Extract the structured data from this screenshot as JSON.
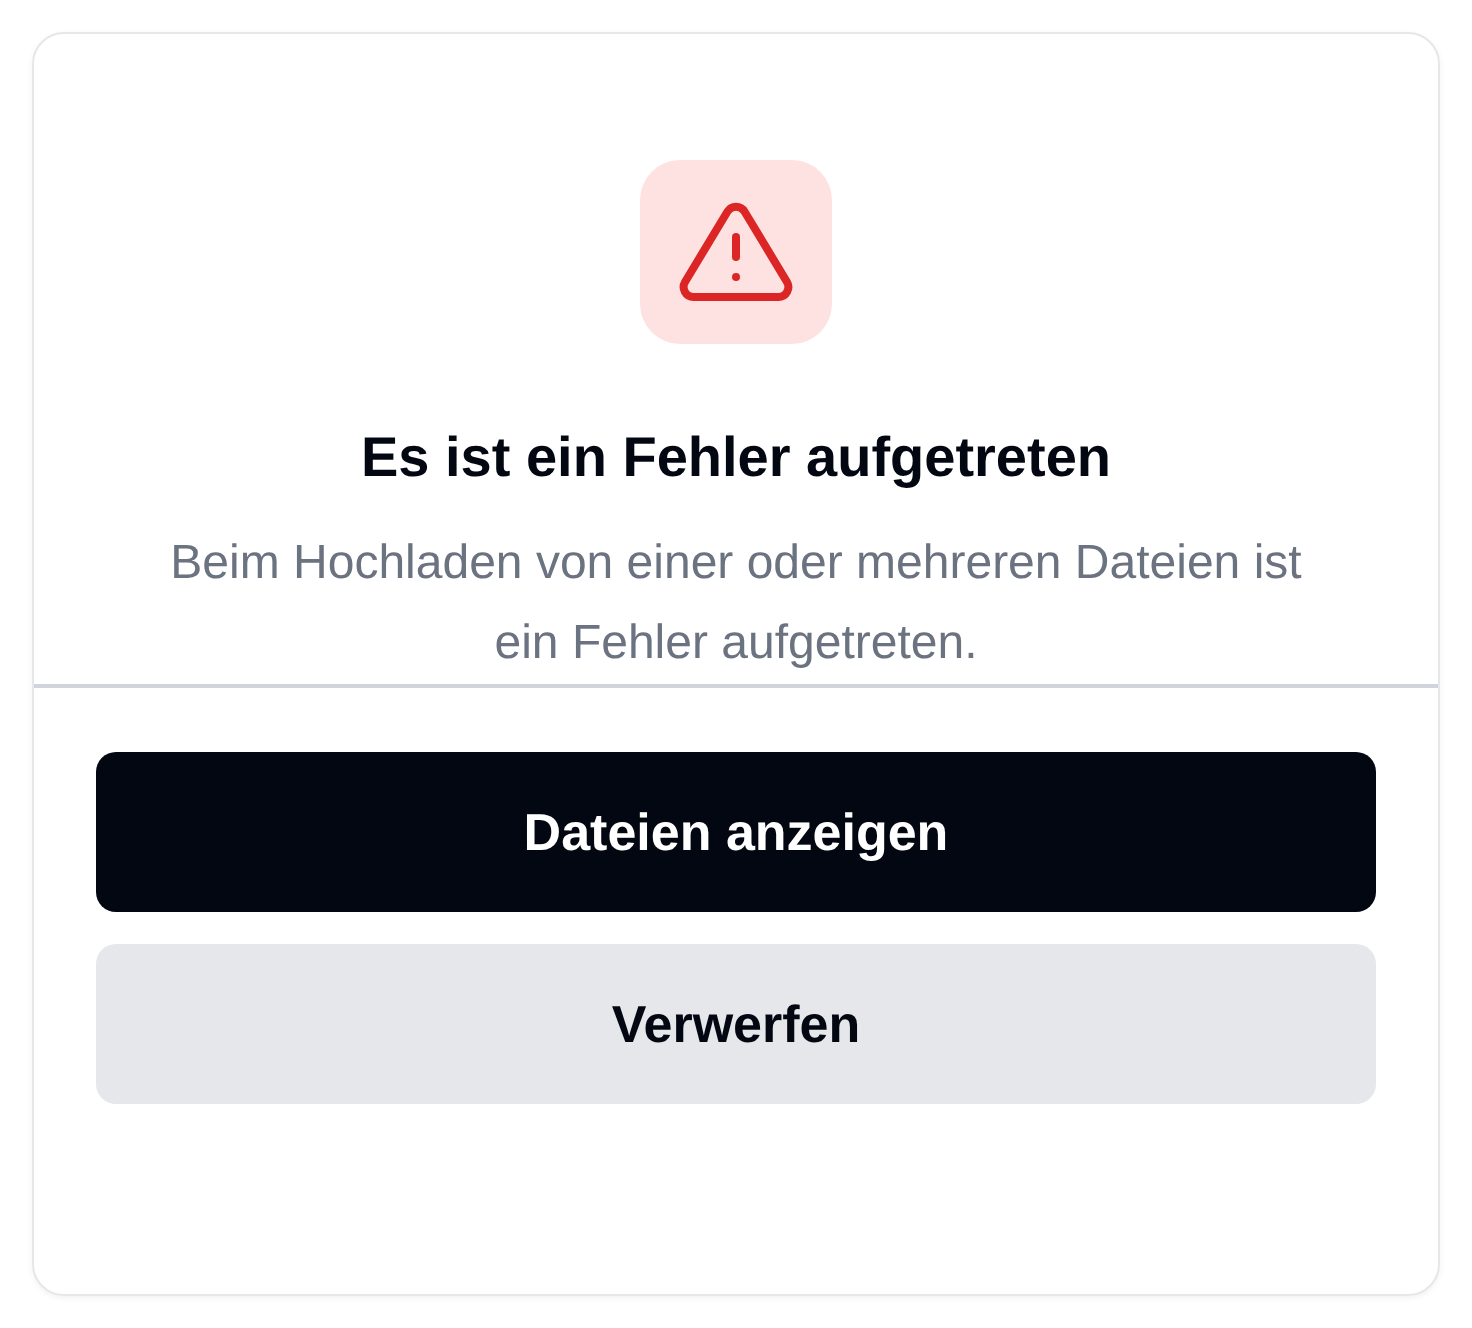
{
  "dialog": {
    "title": "Es ist ein Fehler aufgetreten",
    "message": "Beim Hochladen von einer oder mehreren Dateien ist ein Fehler aufgetreten.",
    "buttons": [
      {
        "label": "Dateien anzeigen",
        "kind": "primary"
      },
      {
        "label": "Verwerfen",
        "kind": "secondary"
      }
    ]
  }
}
